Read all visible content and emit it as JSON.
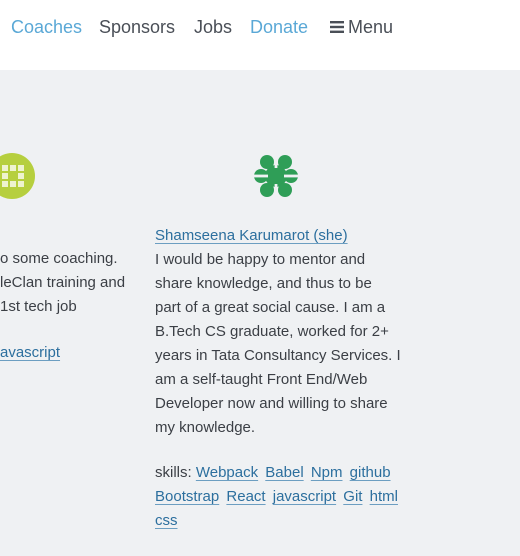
{
  "nav": {
    "items": [
      {
        "label": "Coaches"
      },
      {
        "label": "Sponsors"
      },
      {
        "label": "Jobs"
      },
      {
        "label": "Donate"
      }
    ],
    "menu_label": "Menu",
    "accent_color": "#5aa8d6"
  },
  "left_card": {
    "avatar_color": "#b6cf3e",
    "bio_lines": [
      "o some coaching.",
      "leClan training and",
      "1st tech job"
    ],
    "skill_partial": "avascript"
  },
  "coach": {
    "avatar_color": "#2f9e57",
    "name": "Shamseena Karumarot (she)",
    "bio_lines": [
      "I would be happy to mentor and",
      "share knowledge, and thus to be",
      "part of a great social cause. I am a",
      "B.Tech CS graduate, worked for 2+",
      "years in Tata Consultancy Services. I",
      "am a self-taught Front End/Web",
      "Developer now and willing to share",
      "my knowledge."
    ],
    "skills_label": "skills:",
    "skills": [
      "Webpack",
      "Babel",
      "Npm",
      "github",
      "Bootstrap",
      "React",
      "javascript",
      "Git",
      "html",
      "css"
    ]
  }
}
